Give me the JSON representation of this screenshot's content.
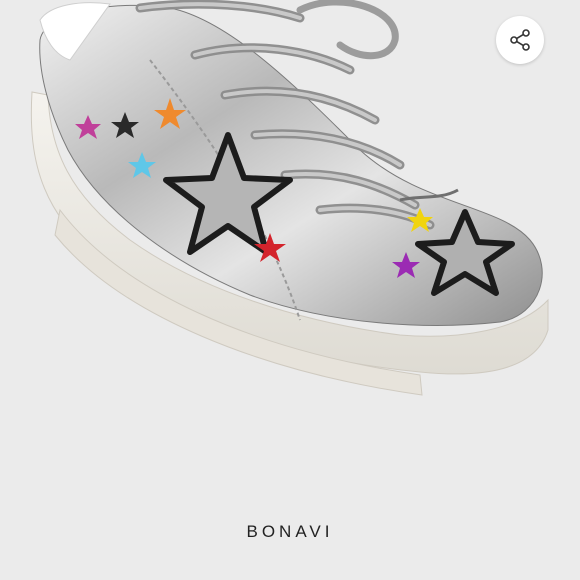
{
  "product": {
    "image_subject": "silver-metallic-star-sneaker",
    "brand": "BONAVI"
  },
  "actions": {
    "share_icon": "share-icon"
  },
  "colors": {
    "background": "#ebebeb",
    "share_button_bg": "#ffffff",
    "brand_text": "#222222"
  }
}
